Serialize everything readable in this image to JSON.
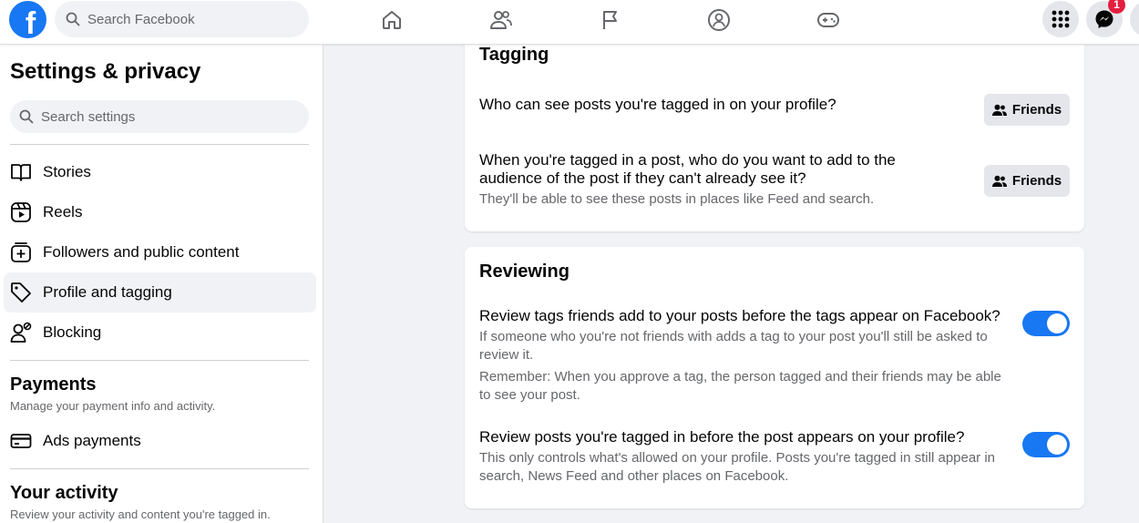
{
  "topbar": {
    "logo_letter": "f",
    "search_placeholder": "Search Facebook",
    "nav_icons": [
      "home-icon",
      "friends-icon",
      "pages-flag-icon",
      "groups-icon",
      "gaming-icon"
    ],
    "menu_icon": "grid-menu-icon",
    "messenger_icon": "messenger-icon",
    "messenger_badge": "1",
    "accent_color": "#1877f2"
  },
  "sidebar": {
    "title": "Settings & privacy",
    "search_placeholder": "Search settings",
    "items": [
      {
        "label": "Stories",
        "icon": "book-icon"
      },
      {
        "label": "Reels",
        "icon": "reels-icon"
      },
      {
        "label": "Followers and public content",
        "icon": "add-box-icon"
      },
      {
        "label": "Profile and tagging",
        "icon": "tag-icon"
      },
      {
        "label": "Blocking",
        "icon": "block-user-icon"
      }
    ],
    "payments": {
      "title": "Payments",
      "description": "Manage your payment info and activity.",
      "items": [
        {
          "label": "Ads payments",
          "icon": "card-icon"
        }
      ]
    },
    "activity": {
      "title": "Your activity",
      "description": "Review your activity and content you're tagged in."
    }
  },
  "main": {
    "tagging": {
      "title": "Tagging",
      "settings": [
        {
          "question": "Who can see posts you're tagged in on your profile?",
          "audience": "Friends"
        },
        {
          "question_line1": "When you're tagged in a post, who do you want to add to the",
          "question_line2": "audience of the post if they can't already see it?",
          "description": "They'll be able to see these posts in places like Feed and search.",
          "audience": "Friends"
        }
      ]
    },
    "reviewing": {
      "title": "Reviewing",
      "settings": [
        {
          "question": "Review tags friends add to your posts before the tags appear on Facebook?",
          "desc1_line1": "If someone who you're not friends with adds a tag to your post you'll still be asked to",
          "desc1_line2": "review it.",
          "desc2_line1": "Remember: When you approve a tag, the person tagged and their friends may be able",
          "desc2_line2": "to see your post.",
          "enabled": true
        },
        {
          "question": "Review posts you're tagged in before the post appears on your profile?",
          "desc_line1": "This only controls what's allowed on your profile. Posts you're tagged in still appear in",
          "desc_line2": "search, News Feed and other places on Facebook.",
          "enabled": true
        }
      ]
    }
  }
}
